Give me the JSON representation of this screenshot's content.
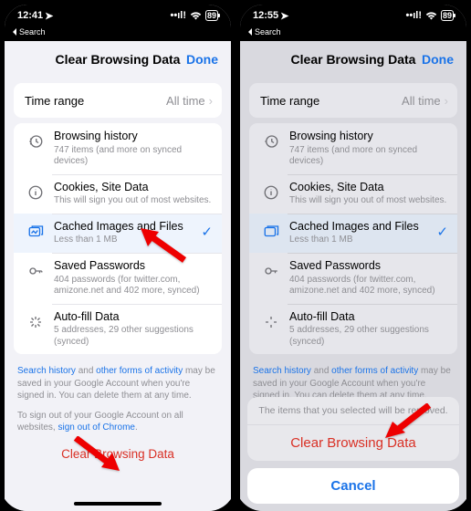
{
  "status": {
    "time_left": "12:41",
    "time_right": "12:55",
    "battery": "89"
  },
  "back": {
    "label": "Search"
  },
  "header": {
    "title": "Clear Browsing Data",
    "done": "Done"
  },
  "range": {
    "label": "Time range",
    "value": "All time"
  },
  "rows": {
    "history": {
      "title": "Browsing history",
      "sub": "747 items (and more on synced devices)"
    },
    "cookies": {
      "title": "Cookies, Site Data",
      "sub": "This will sign you out of most websites."
    },
    "cache": {
      "title": "Cached Images and Files",
      "sub": "Less than 1 MB"
    },
    "passwords": {
      "title": "Saved Passwords",
      "sub": "404 passwords (for twitter.com, amizone.net and 402 more, synced)"
    },
    "autofill": {
      "title": "Auto-fill Data",
      "sub": "5 addresses, 29 other suggestions (synced)"
    }
  },
  "note1": {
    "a": "Search history",
    "b": " and ",
    "c": "other forms of activity",
    "d": " may be saved in your Google Account when you're signed in. You can delete them at any time."
  },
  "note2": {
    "a": "To sign out of your Google Account on all websites, ",
    "b": "sign out of Chrome",
    "c": "."
  },
  "footer": {
    "clear": "Clear Browsing Data"
  },
  "action": {
    "msg": "The items that you selected will be removed.",
    "clear": "Clear Browsing Data",
    "cancel": "Cancel"
  }
}
